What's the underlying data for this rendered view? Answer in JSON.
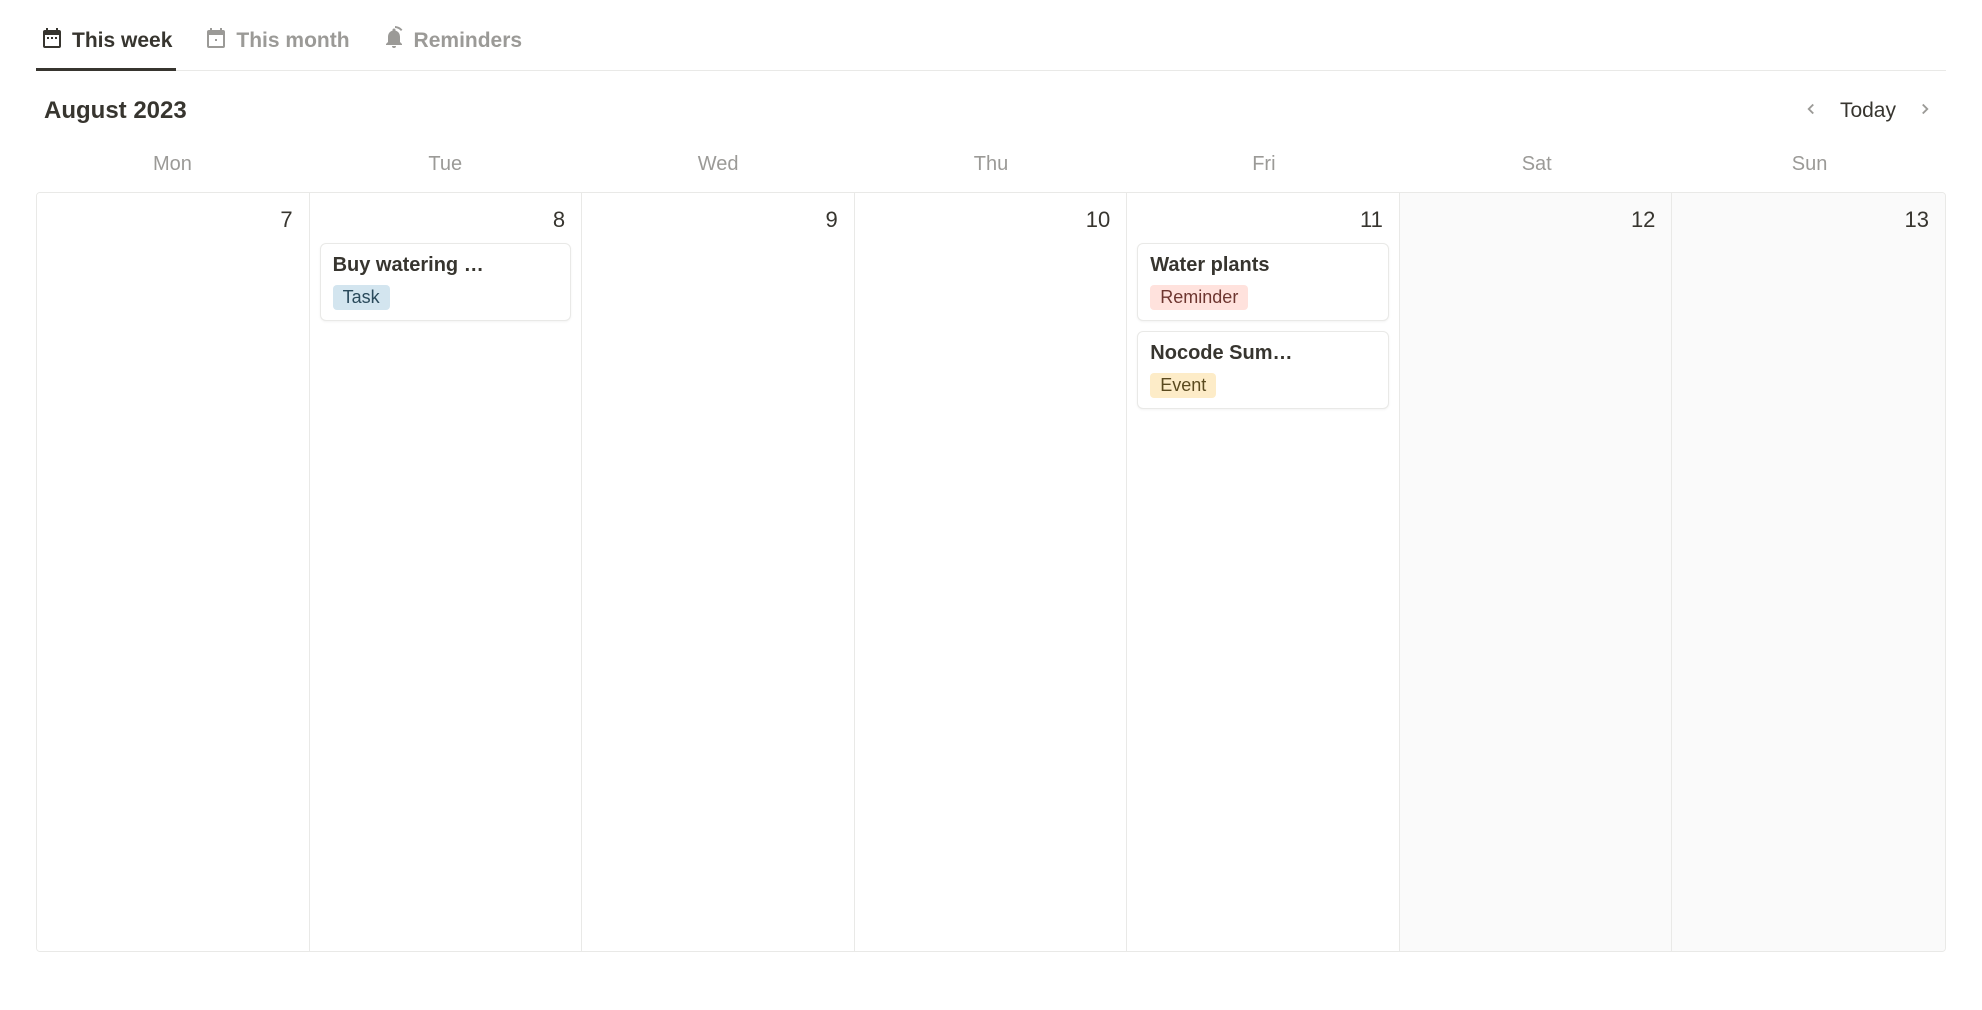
{
  "tabs": {
    "week": {
      "label": "This week"
    },
    "month": {
      "label": "This month"
    },
    "reminders": {
      "label": "Reminders"
    }
  },
  "toolbar": {
    "title": "August 2023",
    "today_label": "Today"
  },
  "day_headers": [
    "Mon",
    "Tue",
    "Wed",
    "Thu",
    "Fri",
    "Sat",
    "Sun"
  ],
  "days": [
    {
      "num": "7",
      "weekend": false,
      "events": []
    },
    {
      "num": "8",
      "weekend": false,
      "events": [
        {
          "title": "Buy watering …",
          "tag_label": "Task",
          "tag_class": "tag-task"
        }
      ]
    },
    {
      "num": "9",
      "weekend": false,
      "events": []
    },
    {
      "num": "10",
      "weekend": false,
      "events": []
    },
    {
      "num": "11",
      "weekend": false,
      "events": [
        {
          "title": "Water plants",
          "tag_label": "Reminder",
          "tag_class": "tag-reminder"
        },
        {
          "title": "Nocode Sum…",
          "tag_label": "Event",
          "tag_class": "tag-event"
        }
      ]
    },
    {
      "num": "12",
      "weekend": true,
      "events": []
    },
    {
      "num": "13",
      "weekend": true,
      "events": []
    }
  ]
}
